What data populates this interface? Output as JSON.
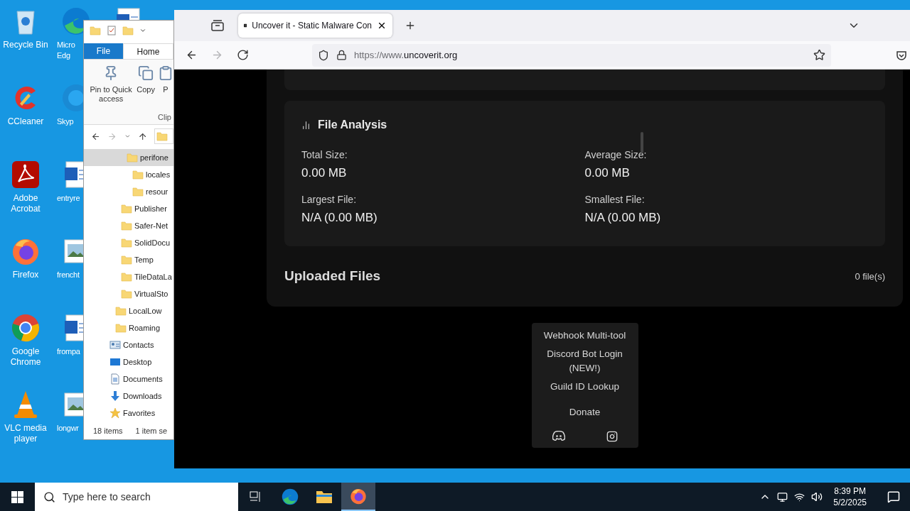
{
  "desktop": {
    "columns": [
      [
        {
          "kind": "recycle-bin",
          "lines": [
            "Recycle Bin"
          ]
        },
        {
          "kind": "ccleaner",
          "lines": [
            "CCleaner"
          ]
        },
        {
          "kind": "acrobat",
          "lines": [
            "Adobe",
            "Acrobat"
          ]
        },
        {
          "kind": "firefox",
          "lines": [
            "Firefox"
          ]
        },
        {
          "kind": "chrome",
          "lines": [
            "Google",
            "Chrome"
          ]
        },
        {
          "kind": "vlc",
          "lines": [
            "VLC media",
            "player"
          ]
        }
      ],
      [
        {
          "kind": "edge",
          "lines": [
            "Micro",
            "Edg"
          ]
        },
        {
          "kind": "skype",
          "lines": [
            "Skyp"
          ]
        },
        {
          "kind": "word",
          "lines": [
            "entryre"
          ]
        },
        {
          "kind": "image",
          "lines": [
            "frencht"
          ]
        },
        {
          "kind": "word",
          "lines": [
            "frompa"
          ]
        },
        {
          "kind": "image",
          "lines": [
            "longwr"
          ]
        }
      ],
      [
        {
          "kind": "word"
        }
      ]
    ]
  },
  "explorer": {
    "tabs": [
      {
        "label": "File",
        "kind": "file-menu",
        "selected": false
      },
      {
        "label": "Home",
        "kind": "tab",
        "selected": true
      }
    ],
    "ribbon": [
      {
        "kind": "pin",
        "label": "Pin to Quick access"
      },
      {
        "kind": "copy",
        "label": "Copy"
      },
      {
        "kind": "paste",
        "label": "P"
      }
    ],
    "group_label": "Clip",
    "tree": [
      {
        "children": [
          {
            "children": [
              {
                "children": [
                  {
                    "label": "perifone",
                    "kind": "folder",
                    "selected": true,
                    "children": [
                      {
                        "label": "locales",
                        "kind": "folder",
                        "selected": false
                      },
                      {
                        "label": "resour",
                        "kind": "folder",
                        "selected": false
                      }
                    ]
                  }
                ]
              },
              {
                "label": "Publisher",
                "kind": "folder",
                "selected": false
              },
              {
                "label": "Safer-Net",
                "kind": "folder",
                "selected": false
              },
              {
                "label": "SolidDocu",
                "kind": "folder",
                "selected": false
              },
              {
                "label": "Temp",
                "kind": "folder",
                "selected": false
              },
              {
                "label": "TileDataLa",
                "kind": "folder",
                "selected": false
              },
              {
                "label": "VirtualSto",
                "kind": "folder",
                "selected": false
              }
            ]
          },
          {
            "label": "LocalLow",
            "kind": "folder",
            "selected": false
          },
          {
            "label": "Roaming",
            "kind": "folder",
            "selected": false
          }
        ]
      },
      {
        "label": "Contacts",
        "kind": "contacts",
        "selected": false
      },
      {
        "label": "Desktop",
        "kind": "desktop",
        "selected": false
      },
      {
        "label": "Documents",
        "kind": "documents",
        "selected": false
      },
      {
        "label": "Downloads",
        "kind": "downloads",
        "selected": false
      },
      {
        "label": "Favorites",
        "kind": "favorites",
        "selected": false
      }
    ],
    "status": [
      "18 items",
      "1 item se"
    ]
  },
  "browser": {
    "tabs": [
      {
        "title": "Uncover it - Static Malware Con",
        "selected": true
      }
    ],
    "nav": [
      {
        "kind": "back",
        "disabled": false
      },
      {
        "kind": "forward",
        "disabled": true
      },
      {
        "kind": "reload",
        "disabled": false
      }
    ],
    "url": {
      "prefix": "https://www.",
      "domain": "uncoverit.org"
    },
    "page": {
      "analysis": {
        "title": "File Analysis",
        "stats": [
          {
            "label": "Total Size:",
            "value": "0.00 MB"
          },
          {
            "label": "Average Size:",
            "value": "0.00 MB"
          },
          {
            "label": "Largest File:",
            "value": "N/A (0.00 MB)"
          },
          {
            "label": "Smallest File:",
            "value": "N/A (0.00 MB)"
          }
        ]
      },
      "uploaded": {
        "title": "Uploaded Files",
        "count": "0 file(s)"
      },
      "footer_menu": {
        "links": [
          "Webhook Multi-tool",
          "Discord Bot Login (NEW!)",
          "Guild ID Lookup",
          "Donate"
        ],
        "socials": [
          {
            "kind": "discord"
          },
          {
            "kind": "instagram"
          }
        ]
      }
    }
  },
  "taskbar": {
    "search": {
      "placeholder": "Type here to search"
    },
    "apps": [
      {
        "kind": "task-view",
        "selected": false
      },
      {
        "kind": "edge",
        "selected": false
      },
      {
        "kind": "explorer",
        "selected": false
      },
      {
        "kind": "firefox",
        "selected": true
      }
    ],
    "time": "8:39 PM",
    "date": "5/2/2025"
  }
}
